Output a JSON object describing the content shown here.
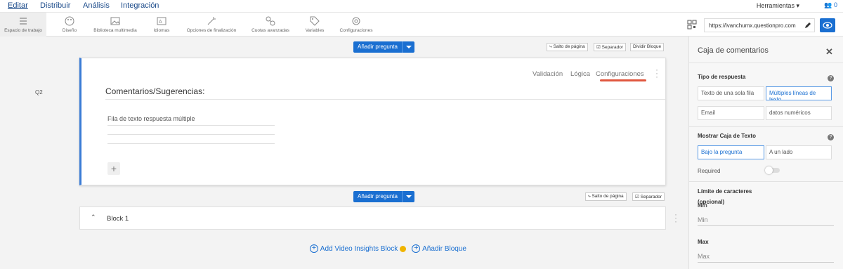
{
  "topnav": {
    "items": [
      "Editar",
      "Distribuir",
      "Análisis",
      "Integración"
    ],
    "tools_label": "Herramientas",
    "users_count": "0"
  },
  "toolbar": {
    "items": [
      "Espacio de trabajo",
      "Diseño",
      "Biblioteca multimedia",
      "Idiomas",
      "Opciones de finalización",
      "Cuotas avanzadas",
      "Variables",
      "Configuraciones"
    ],
    "url": "https://ivanchumx.questionpro.com"
  },
  "gutter": {
    "question_id": "Q2"
  },
  "separator_top": {
    "add_question": "Añadir pregunta",
    "page_break": "Salto de página",
    "separator": "Separador",
    "split_block": "Dividir Bloque"
  },
  "question": {
    "tabs": [
      "Validación",
      "Lógica",
      "Configuraciones"
    ],
    "title": "Comentarios/Sugerencias:",
    "answer_placeholder": "Fila de texto respuesta múltiple",
    "add_symbol": "+"
  },
  "separator_bottom": {
    "add_question": "Añadir pregunta",
    "page_break": "Salto de página",
    "separator": "Separador"
  },
  "block": {
    "label": "Block 1"
  },
  "bottom": {
    "add_video": "Add Video Insights Block",
    "add_block": "Añadir Bloque"
  },
  "panel": {
    "title": "Caja de comentarios",
    "response_type_title": "Tipo de respuesta",
    "response_types": [
      "Texto de una sola fila",
      "Múltiples líneas de texto",
      "Email",
      "datos numéricos"
    ],
    "show_textbox_title": "Mostrar Caja de Texto",
    "show_options": [
      "Bajo la pregunta",
      "A un lado"
    ],
    "required_label": "Required",
    "char_limit_title": "Límite de caracteres",
    "char_limit_optional": "(opcional)",
    "min_label": "Min",
    "min_placeholder": "Min",
    "max_label": "Max",
    "max_placeholder": "Max"
  },
  "colors": {
    "accent": "#1a6fd1",
    "highlight": "#e0573f",
    "active_bar": "#3a7bd5"
  }
}
